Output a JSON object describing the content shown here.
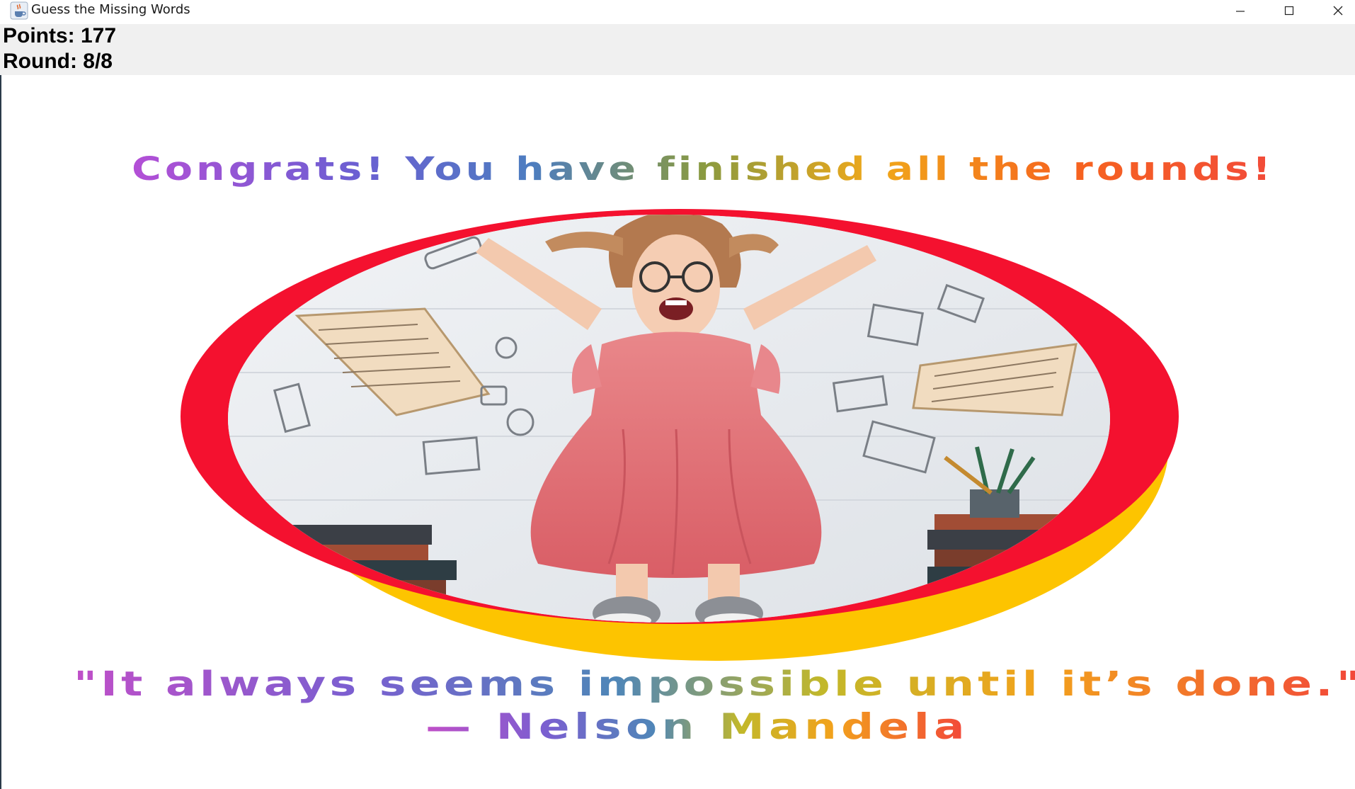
{
  "window": {
    "title": "Guess the Missing Words",
    "icon": "java-cup-icon",
    "controls": [
      "minimize-icon",
      "maximize-icon",
      "close-icon"
    ]
  },
  "status": {
    "points_label": "Points: 177",
    "round_label": "Round: 8/8"
  },
  "content": {
    "headline": "Congrats! You have finished all the rounds!",
    "quote_line1": "\"It always seems impossible until it’s done.\"",
    "quote_line2": "— Nelson Mandela"
  },
  "colors": {
    "ring_red": "#f4112f",
    "ring_yellow": "#fdc400",
    "gradient": [
      "#b44fd6",
      "#6a5fd2",
      "#4d7dc0",
      "#8a9a40",
      "#f0a81a",
      "#f6641e",
      "#f24b3a"
    ],
    "status_bg": "#f0f0f0"
  }
}
